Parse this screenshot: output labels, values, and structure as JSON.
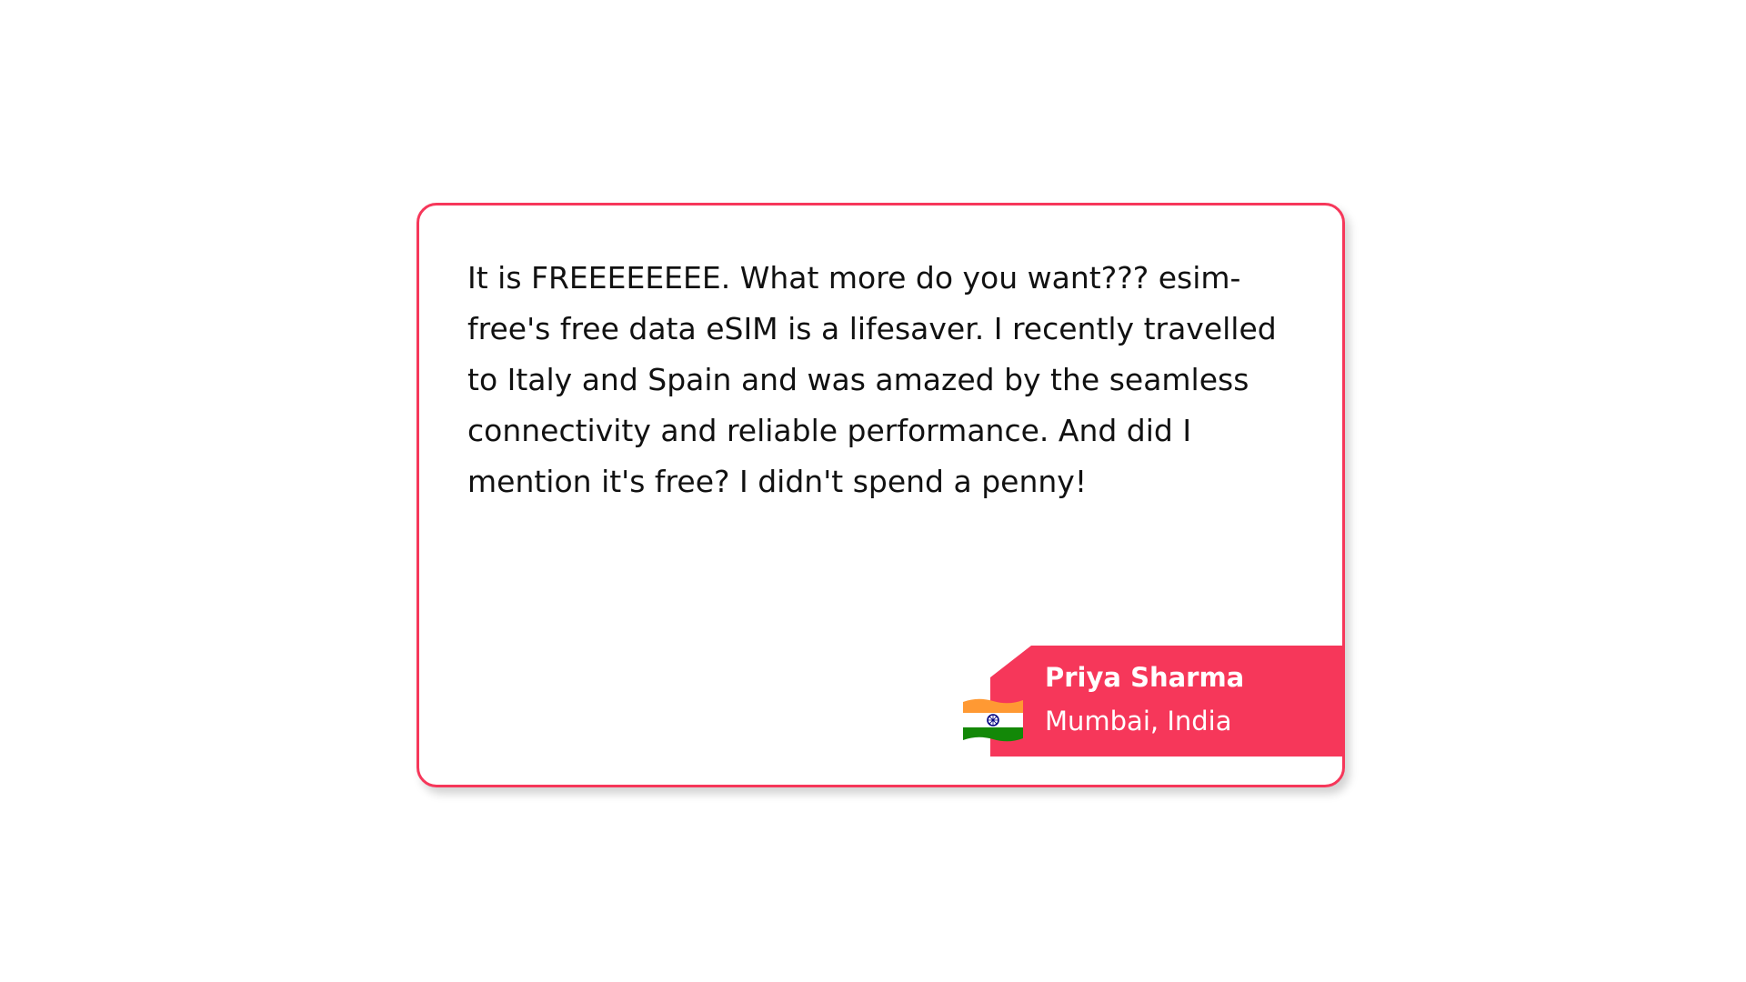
{
  "testimonial": {
    "quote": "It is FREEEEEEEE. What more do you want??? esim-free's free data eSIM is a lifesaver. I recently travelled to Italy and Spain and was amazed by the seamless connectivity and reliable performance. And did I mention it's free? I didn't spend a penny!",
    "author_name": "Priya Sharma",
    "author_location": "Mumbai, India",
    "flag_icon": "india-flag-icon"
  },
  "colors": {
    "accent": "#f6375a",
    "text": "#111111",
    "background": "#ffffff"
  }
}
